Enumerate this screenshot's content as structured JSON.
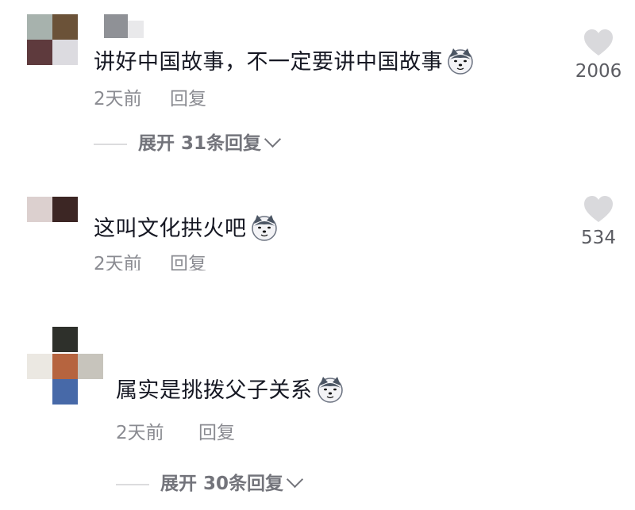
{
  "comments": [
    {
      "text": "讲好中国故事，不一定要讲中国故事",
      "emoji": "dog-face-emoji",
      "time": "2天前",
      "reply_label": "回复",
      "like_count": "2006",
      "expand_label": "展开 31条回复"
    },
    {
      "text": "这叫文化拱火吧",
      "emoji": "dog-face-emoji",
      "time": "2天前",
      "reply_label": "回复",
      "like_count": "534"
    },
    {
      "text": "属实是挑拨父子关系",
      "emoji": "dog-face-emoji",
      "time": "2天前",
      "reply_label": "回复",
      "expand_label": "展开 30条回复"
    }
  ],
  "colors": {
    "text": "#161823",
    "meta": "#8a8b91",
    "heart": "#d9d9dc"
  }
}
